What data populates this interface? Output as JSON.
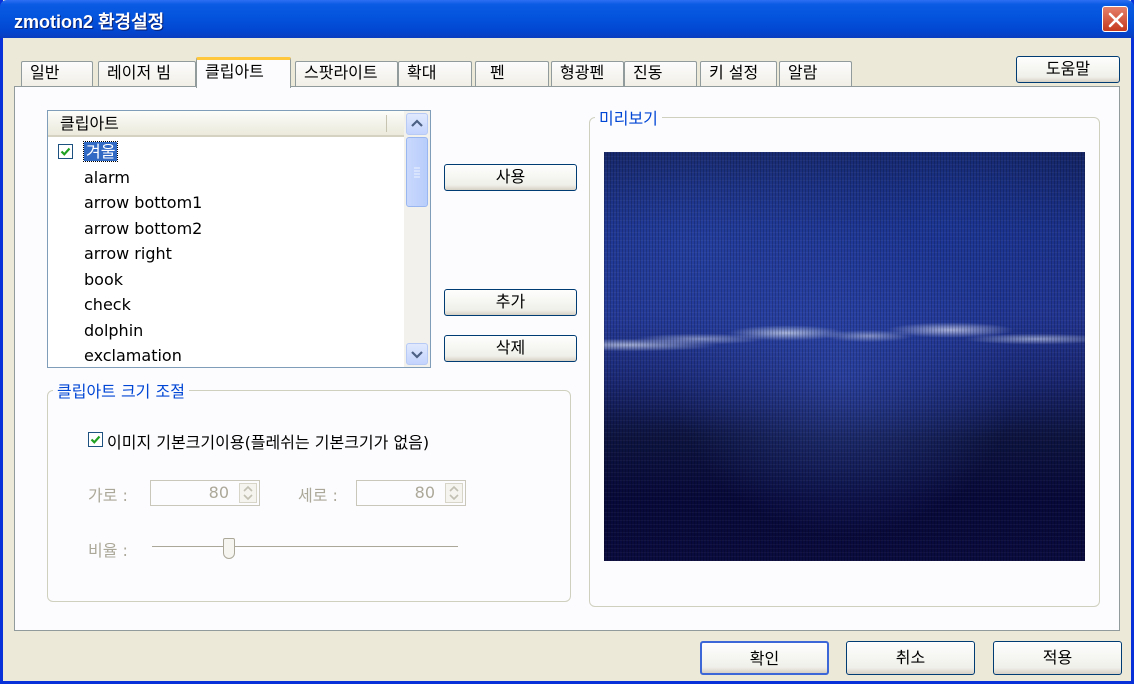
{
  "window": {
    "title": "zmotion2 환경설정"
  },
  "tabs": [
    {
      "label": "일반"
    },
    {
      "label": "레이저 빔"
    },
    {
      "label": "클립아트"
    },
    {
      "label": "스팟라이트"
    },
    {
      "label": "확대"
    },
    {
      "label": "펜"
    },
    {
      "label": "형광펜"
    },
    {
      "label": "진동"
    },
    {
      "label": "키 설정"
    },
    {
      "label": "알람"
    }
  ],
  "active_tab": "클립아트",
  "help_button": "도움말",
  "cliplist": {
    "header": "클립아트",
    "items": [
      {
        "label": "겨울",
        "checked": true,
        "selected": true
      },
      {
        "label": "alarm"
      },
      {
        "label": "arrow bottom1"
      },
      {
        "label": "arrow bottom2"
      },
      {
        "label": "arrow right"
      },
      {
        "label": "book"
      },
      {
        "label": "check"
      },
      {
        "label": "dolphin"
      },
      {
        "label": "exclamation"
      }
    ]
  },
  "side_buttons": {
    "use": "사용",
    "add": "추가",
    "delete": "삭제"
  },
  "size_group": {
    "title": "클립아트 크기 조절",
    "use_default_label": "이미지 기본크기이용(플레쉬는 기본크기가 없음)",
    "use_default_checked": true,
    "width_label": "가로 :",
    "width_value": "80",
    "height_label": "세로 :",
    "height_value": "80",
    "ratio_label": "비율 :",
    "ratio_level": 0.25
  },
  "preview_group": {
    "title": "미리보기"
  },
  "footer": {
    "ok": "확인",
    "cancel": "취소",
    "apply": "적용"
  },
  "colors": {
    "title_bar": "#0454dd",
    "accent": "#0046d5",
    "selection": "#316ac5",
    "face": "#ece9d8"
  }
}
